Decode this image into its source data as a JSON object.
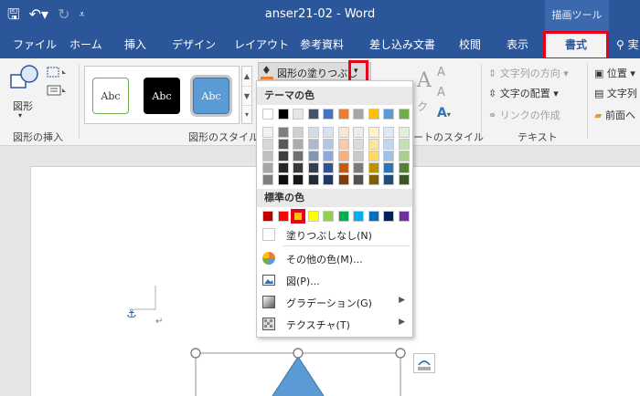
{
  "window": {
    "title": "anser21-02  -  Word",
    "context_tab_title": "描画ツール"
  },
  "tabs": [
    {
      "label": "ファイル"
    },
    {
      "label": "ホーム"
    },
    {
      "label": "挿入"
    },
    {
      "label": "デザイン"
    },
    {
      "label": "レイアウト"
    },
    {
      "label": "参考資料"
    },
    {
      "label": "差し込み文書"
    },
    {
      "label": "校閲"
    },
    {
      "label": "表示"
    },
    {
      "label": "書式",
      "active": true
    },
    {
      "label": "実"
    }
  ],
  "ribbon": {
    "insert_shape": {
      "button": "図形",
      "label": "図形の挿入"
    },
    "shape_styles": {
      "label": "図形のスタイル",
      "abc": [
        "Abc",
        "Abc",
        "Abc"
      ],
      "fill_button": "図形の塗りつぶし"
    },
    "wordart": {
      "label": "ートのスタイル",
      "chars": [
        "A",
        "A",
        "A",
        "ク"
      ]
    },
    "text": {
      "label": "テキスト",
      "direction": "文字列の方向",
      "align": "文字の配置",
      "link": "リンクの作成"
    },
    "arrange": {
      "position": "位置",
      "wrap": "文字列",
      "front": "前面へ"
    }
  },
  "fill_menu": {
    "theme_header": "テーマの色",
    "standard_header": "標準の色",
    "theme_top": [
      "#ffffff",
      "#000000",
      "#e7e6e6",
      "#44546a",
      "#4472c4",
      "#ed7d31",
      "#a5a5a5",
      "#ffc000",
      "#5b9bd5",
      "#70ad47"
    ],
    "theme_shades": [
      [
        "#f2f2f2",
        "#7f7f7f",
        "#d0cece",
        "#d6dce4",
        "#d9e2f3",
        "#fbe5d5",
        "#ededed",
        "#fff2cc",
        "#deebf6",
        "#e2efd9"
      ],
      [
        "#d8d8d8",
        "#595959",
        "#aeabab",
        "#adb9ca",
        "#b4c6e7",
        "#f7cbac",
        "#dbdbdb",
        "#fee599",
        "#bdd7ee",
        "#c5e0b3"
      ],
      [
        "#bfbfbf",
        "#3f3f3f",
        "#757070",
        "#8496b0",
        "#8eaadb",
        "#f4b183",
        "#c9c9c9",
        "#ffd965",
        "#9cc3e5",
        "#a8d08d"
      ],
      [
        "#a5a5a5",
        "#262626",
        "#3a3838",
        "#323f4f",
        "#2f5496",
        "#c55a11",
        "#7b7b7b",
        "#bf9000",
        "#2e75b5",
        "#538135"
      ],
      [
        "#7f7f7f",
        "#0c0c0c",
        "#171616",
        "#222a35",
        "#1f3864",
        "#843c0b",
        "#525252",
        "#7f6000",
        "#1e4e79",
        "#375623"
      ]
    ],
    "standard": [
      "#c00000",
      "#ff0000",
      "#ffc000",
      "#ffff00",
      "#92d050",
      "#00b050",
      "#00b0f0",
      "#0070c0",
      "#002060",
      "#7030a0"
    ],
    "selected_standard_index": 2,
    "items": {
      "no_fill": "塗りつぶしなし(N)",
      "more_colors": "その他の色(M)...",
      "picture": "図(P)...",
      "gradient": "グラデーション(G)",
      "texture": "テクスチャ(T)"
    }
  },
  "document": {
    "anchor": "⚓",
    "para_mark": "↵"
  },
  "colors": {
    "titlebar": "#2b579a",
    "highlight": "#e8001c",
    "shape_fill": "#5b9bd5"
  }
}
